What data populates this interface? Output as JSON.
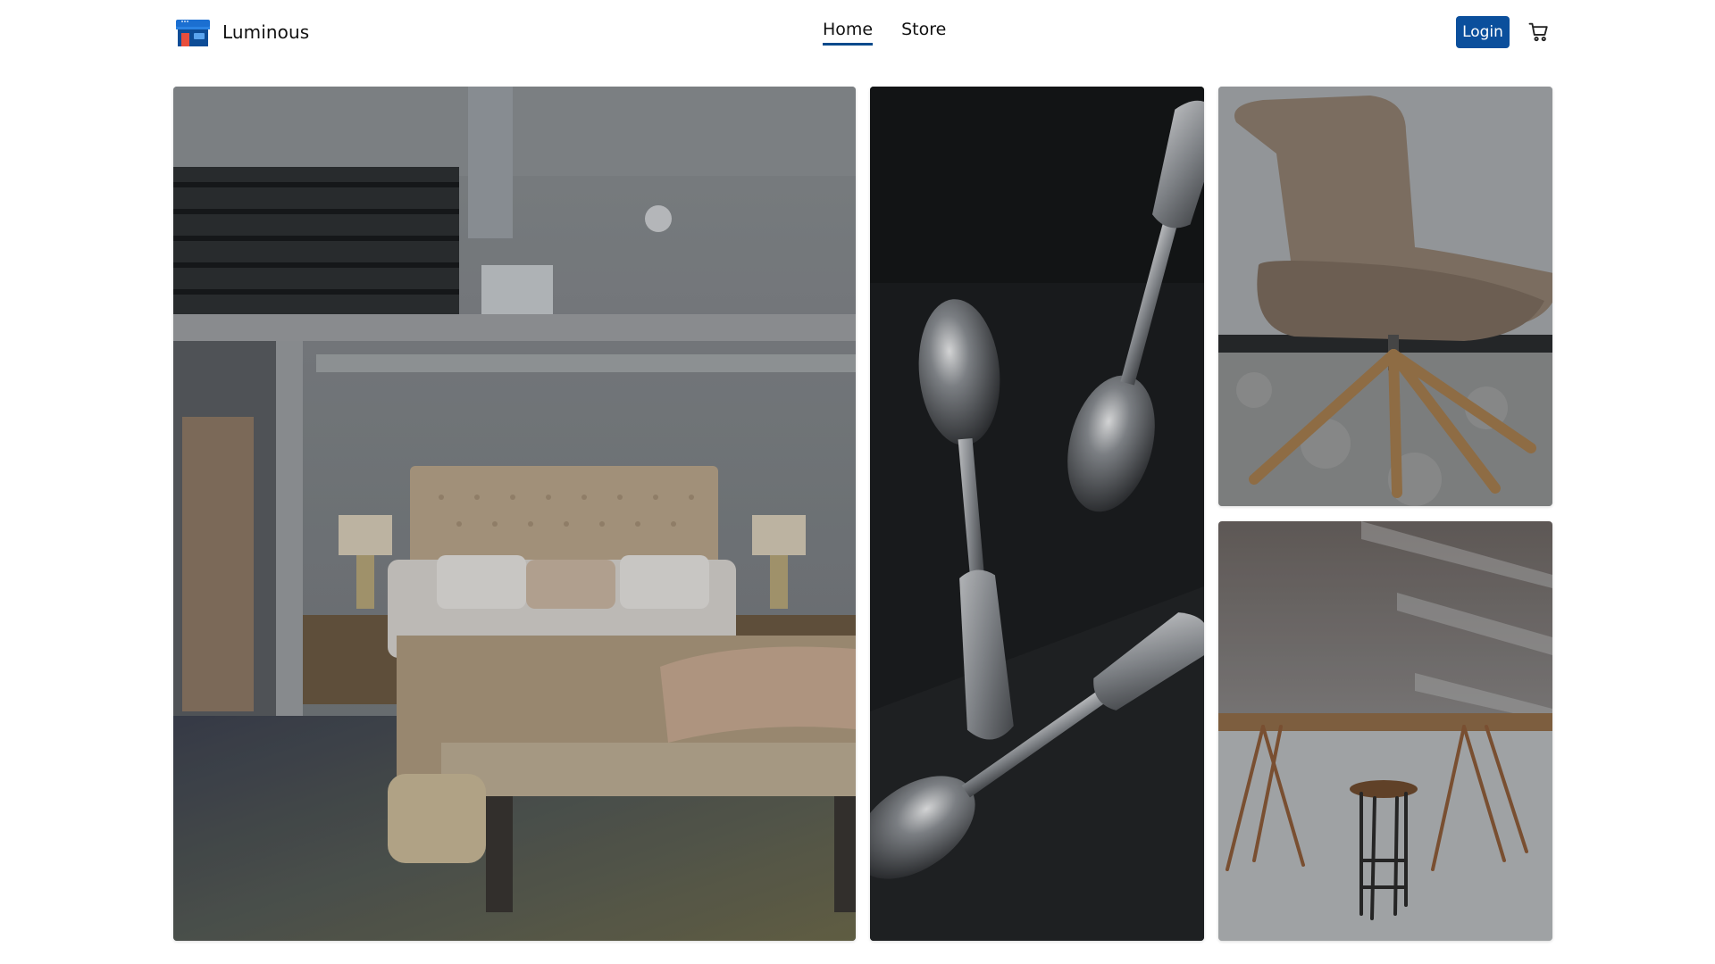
{
  "brand": {
    "name": "Luminous",
    "logo_icon": "storefront-icon"
  },
  "nav": {
    "items": [
      {
        "label": "Home",
        "active": true
      },
      {
        "label": "Store",
        "active": false
      }
    ]
  },
  "header_actions": {
    "login_label": "Login",
    "cart_icon": "shopping-cart-icon"
  },
  "colors": {
    "primary": "#0b4f9c",
    "active_underline": "#0a4a8c"
  },
  "gallery": {
    "tiles": [
      {
        "subject": "bedroom-image"
      },
      {
        "subject": "spoons-image"
      },
      {
        "subject": "chair-image"
      },
      {
        "subject": "table-image"
      }
    ]
  }
}
